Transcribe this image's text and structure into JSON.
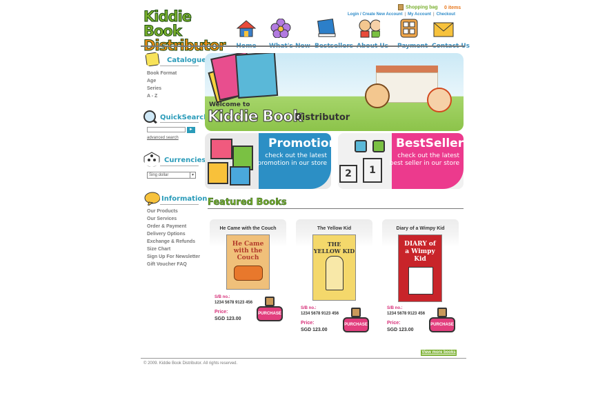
{
  "header": {
    "logo_line1": "Kiddie Book",
    "logo_line2": "Distributor",
    "shopping_bag": "Shopping bag",
    "items": "0 items",
    "links": {
      "login": "Login / Create New Account",
      "my_account": "My Account",
      "checkout": "Checkout"
    }
  },
  "nav": [
    {
      "label": "Home",
      "icon": "house-icon",
      "color": "#e94a3a"
    },
    {
      "label": "What's New",
      "icon": "flower-icon",
      "color": "#b27ae0"
    },
    {
      "label": "Bestsellers",
      "icon": "book-icon",
      "color": "#2c7fc9"
    },
    {
      "label": "About Us",
      "icon": "kids-icon",
      "color": "#f0a64a"
    },
    {
      "label": "Payment",
      "icon": "calculator-icon",
      "color": "#f0a64a"
    },
    {
      "label": "Contact Us",
      "icon": "envelope-icon",
      "color": "#f7c23c"
    }
  ],
  "sidebar": {
    "catalogue": {
      "title": "Catalogue",
      "items": [
        "Book Format",
        "Age",
        "Series",
        "A - Z"
      ]
    },
    "quicksearch": {
      "title": "QuickSearch",
      "advanced": "advanced search"
    },
    "currencies": {
      "title": "Currencies",
      "selected": "Sing dollar"
    },
    "information": {
      "title": "Information",
      "items": [
        "Our Products",
        "Our Services",
        "Order & Payment",
        "Delivery Options",
        "Exchange & Refunds",
        "Size Chart",
        "Sign Up For Newsletter",
        "Gift Voucher FAQ"
      ]
    }
  },
  "welcome": {
    "line1": "Welcome to",
    "line2": "Kiddie Book",
    "line3": "Distributor"
  },
  "promotion": {
    "title": "Promotion",
    "sub1": "check out the latest",
    "sub2": "promotion in our store"
  },
  "bestsellers": {
    "title": "BestSellers",
    "sub1": "check out the latest",
    "sub2": "best seller in our store",
    "podium_2": "2",
    "podium_1": "1"
  },
  "featured": {
    "title": "Featured Books",
    "sb_label": "S/B no.:",
    "price_label": "Price:",
    "purchase": "PURCHASE",
    "books": [
      {
        "title": "He Came with the Couch",
        "cover_text": "He Came with the Couch",
        "sb": "1234 5678 9123 456",
        "price": "SGD 123.00",
        "cover_color": "#f0c07a"
      },
      {
        "title": "The Yellow Kid",
        "cover_text": "THE YELLOW KID",
        "sb": "1234 5678 9123 456",
        "price": "SGD 123.00",
        "cover_color": "#f4d86b"
      },
      {
        "title": "Diary of a Wimpy Kid",
        "cover_text": "DIARY of a Wimpy Kid",
        "sb": "1234 5678 9123 456",
        "price": "SGD 123.00",
        "cover_color": "#c8242a"
      }
    ],
    "view_more": "View more books »"
  },
  "footer": {
    "copyright": "© 2009. Kiddie Book Distributor. All rights reserved."
  }
}
